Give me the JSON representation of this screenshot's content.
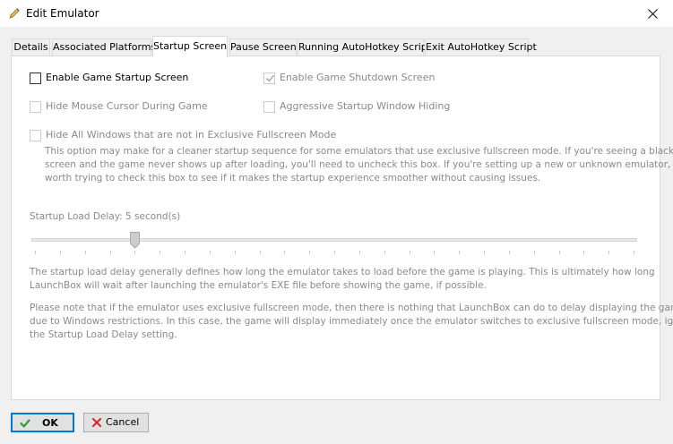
{
  "window": {
    "title": "Edit Emulator",
    "icon": "pencil-icon",
    "close_icon": "close-icon"
  },
  "tabs": [
    {
      "label": "Details",
      "active": false
    },
    {
      "label": "Associated Platforms",
      "active": false
    },
    {
      "label": "Startup Screen",
      "active": true
    },
    {
      "label": "Pause Screen",
      "active": false
    },
    {
      "label": "Running AutoHotkey Script",
      "active": false
    },
    {
      "label": "Exit AutoHotkey Script",
      "active": false
    }
  ],
  "options": {
    "enable_startup": {
      "label": "Enable Game Startup Screen",
      "checked": false,
      "enabled": true
    },
    "enable_shutdown": {
      "label": "Enable Game Shutdown Screen",
      "checked": true,
      "enabled": false
    },
    "hide_cursor": {
      "label": "Hide Mouse Cursor During Game",
      "checked": false,
      "enabled": false
    },
    "aggressive_hiding": {
      "label": "Aggressive Startup Window Hiding",
      "checked": false,
      "enabled": false
    },
    "hide_windows": {
      "label": "Hide All Windows that are not in Exclusive Fullscreen Mode",
      "checked": false,
      "enabled": false
    }
  },
  "hide_windows_description": [
    "This option may make for a cleaner startup sequence for some emulators that use exclusive fullscreen mode. If you're seeing a black",
    "screen and the game never shows up after loading, you'll need to uncheck this box. If you're setting up a new or unknown emulator, it's",
    "worth trying to check this box to see if it makes the startup experience smoother without causing issues."
  ],
  "load_delay": {
    "label": "Startup Load Delay: 5 second(s)",
    "value_seconds": 5,
    "tick_count": 25
  },
  "delay_description_1": [
    "The startup load delay generally defines how long the emulator takes to load before the game is playing. This is ultimately how long",
    "LaunchBox will wait after launching the emulator's EXE file before showing the game, if possible."
  ],
  "delay_description_2": [
    "Please note that if the emulator uses exclusive fullscreen mode, then there is nothing that LaunchBox can do to delay displaying the game,",
    "due to Windows restrictions. In this case, the game will display immediately once the emulator switches to exclusive fullscreen mode, ignoring",
    "the Startup Load Delay setting."
  ],
  "buttons": {
    "ok": {
      "label": "OK",
      "icon": "checkmark-icon",
      "icon_color": "#2e9e2e"
    },
    "cancel": {
      "label": "Cancel",
      "icon": "x-icon",
      "icon_color": "#d32f2f"
    }
  },
  "colors": {
    "accent": "#0078d7",
    "disabled_text": "#8a8a8a"
  }
}
